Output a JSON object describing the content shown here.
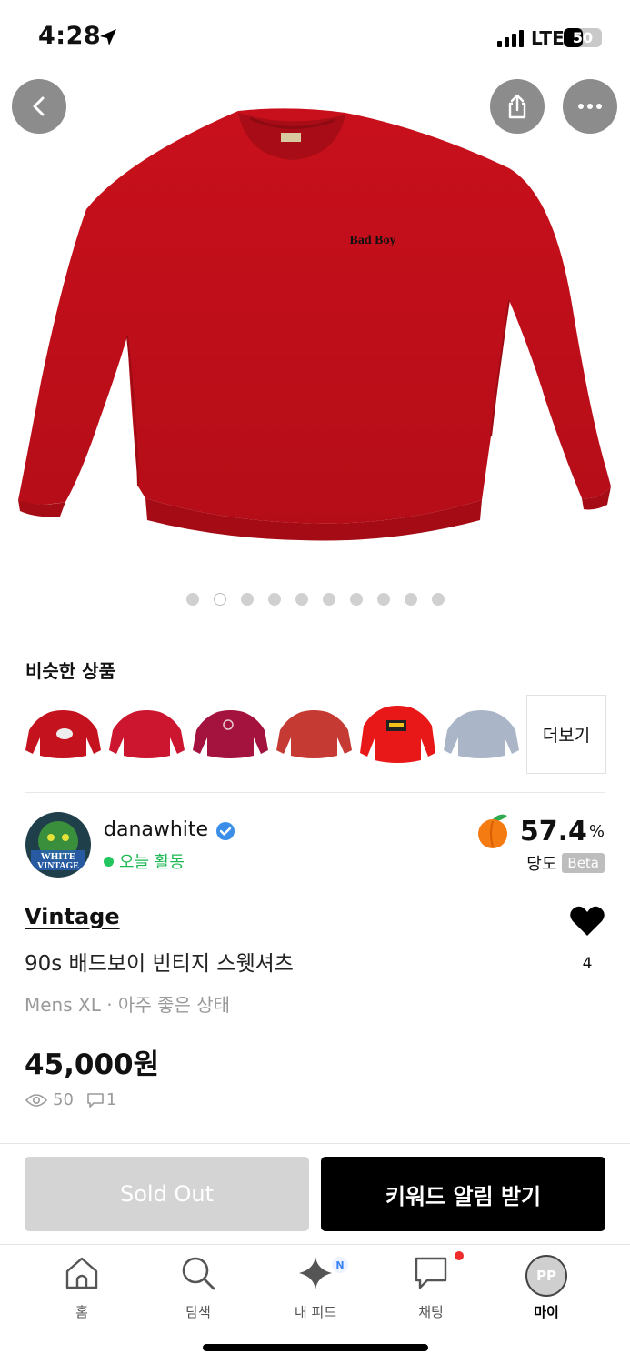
{
  "status_bar": {
    "time": "4:28",
    "network": "LTE",
    "battery": "50",
    "battery_level_percent": 50
  },
  "hero": {
    "image_text": "Bad Boy",
    "image_count": 10,
    "active_index": 1
  },
  "similar": {
    "title": "비슷한 상품",
    "more_label": "더보기",
    "thumbnail_colors": [
      "#c5121f",
      "#cc1630",
      "#a3133e",
      "#c53a32",
      "#e81818",
      "#aab6c8"
    ]
  },
  "seller": {
    "name": "danawhite",
    "activity": "오늘 활동",
    "avatar_text": [
      "WHITE",
      "VINTAGE"
    ],
    "score": "57.4",
    "score_unit": "%",
    "score_label": "당도",
    "beta": "Beta"
  },
  "product": {
    "brand": "Vintage",
    "title": "90s 배드보이 빈티지 스웻셔츠",
    "meta": "Mens XL · 아주 좋은 상태",
    "price": "45,000원",
    "views": "50",
    "comments": "1",
    "likes": "4"
  },
  "actions": {
    "sold_out": "Sold Out",
    "keyword_alert": "키워드 알림 받기"
  },
  "tabbar": {
    "tabs": [
      {
        "label": "홈",
        "icon": "home-icon"
      },
      {
        "label": "탐색",
        "icon": "search-icon"
      },
      {
        "label": "내 피드",
        "icon": "sparkle-icon",
        "badge": "N"
      },
      {
        "label": "채팅",
        "icon": "chat-icon"
      },
      {
        "label": "마이",
        "icon": "avatar",
        "avatar_text": "PP"
      }
    ]
  },
  "colors": {
    "accent": "#000000",
    "active_green": "#22c55e",
    "verified_blue": "#3b8fe8",
    "sweater_red": "#c8101c"
  }
}
